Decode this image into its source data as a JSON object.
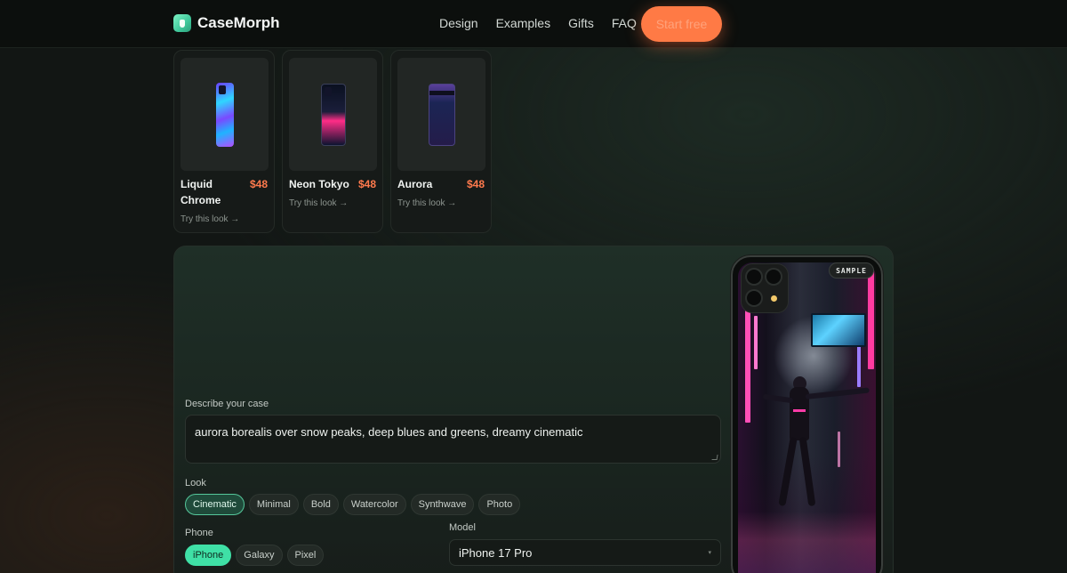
{
  "brand": {
    "name": "CaseMorph"
  },
  "nav": {
    "items": [
      "Design",
      "Examples",
      "Gifts",
      "FAQ"
    ],
    "cta": "Start free"
  },
  "products": [
    {
      "name": "Liquid Chrome",
      "price": "$48",
      "link": "Try this look →"
    },
    {
      "name": "Neon Tokyo",
      "price": "$48",
      "link": "Try this look →"
    },
    {
      "name": "Aurora",
      "price": "$48",
      "link": "Try this look →"
    }
  ],
  "designer": {
    "prompt_label": "Describe your case",
    "prompt_value": "aurora borealis over snow peaks, deep blues and greens, dreamy cinematic",
    "look_label": "Look",
    "looks": [
      "Cinematic",
      "Minimal",
      "Bold",
      "Watercolor",
      "Synthwave",
      "Photo"
    ],
    "look_selected": "Cinematic",
    "phone_label": "Phone",
    "phones": [
      "iPhone",
      "Galaxy",
      "Pixel"
    ],
    "phone_selected": "iPhone",
    "model_label": "Model",
    "model_value": "iPhone 17 Pro"
  },
  "preview": {
    "badge": "SAMPLE"
  },
  "colors": {
    "accent": "#3fe0a6",
    "cta": "#ff7a45",
    "price": "#ff7a4d"
  },
  "icons": [
    "casemorph-logo-icon",
    "chevron-down-icon",
    "resize-grip-icon"
  ]
}
